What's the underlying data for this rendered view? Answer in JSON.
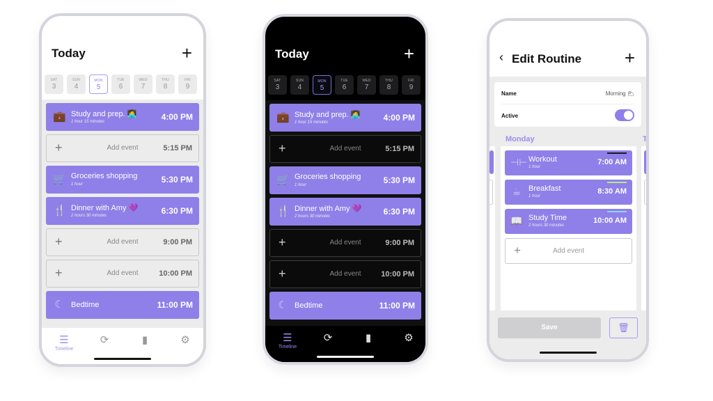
{
  "light": {
    "title": "Today",
    "days": [
      {
        "dow": "SAT",
        "num": "3"
      },
      {
        "dow": "SUN",
        "num": "4"
      },
      {
        "dow": "MON",
        "num": "5",
        "selected": true
      },
      {
        "dow": "TUE",
        "num": "6"
      },
      {
        "dow": "WED",
        "num": "7"
      },
      {
        "dow": "THU",
        "num": "8"
      },
      {
        "dow": "FRI",
        "num": "9"
      }
    ],
    "rows": [
      {
        "type": "event",
        "icon": "briefcase-icon",
        "name": "Study and prep. 🧑‍💻",
        "duration": "1 hour 15 minutes",
        "time": "4:00 PM"
      },
      {
        "type": "add",
        "label": "Add event",
        "time": "5:15 PM"
      },
      {
        "type": "event",
        "icon": "cart-icon",
        "name": "Groceries shopping",
        "duration": "1 hour",
        "time": "5:30 PM"
      },
      {
        "type": "event",
        "icon": "utensils-icon",
        "name": "Dinner with Amy 💜",
        "duration": "2 hours 30 minutes",
        "time": "6:30 PM"
      },
      {
        "type": "add",
        "label": "Add event",
        "time": "9:00 PM"
      },
      {
        "type": "add",
        "label": "Add event",
        "time": "10:00 PM"
      },
      {
        "type": "event",
        "icon": "moon-icon",
        "name": "Bedtime",
        "duration": "",
        "time": "11:00 PM"
      }
    ],
    "tabs": [
      {
        "label": "Timeline"
      }
    ]
  },
  "routine": {
    "title": "Edit Routine",
    "name_label": "Name",
    "name_value": "Morning 🌥",
    "active_label": "Active",
    "active": true,
    "column": "Monday",
    "next_column_initial": "T",
    "rows": [
      {
        "icon": "dumbbell-icon",
        "name": "Workout",
        "duration": "1 hour",
        "time": "7:00 AM",
        "tag": "#1a1a2e"
      },
      {
        "icon": "cup-icon",
        "name": "Breakfast",
        "duration": "1 hour",
        "time": "8:30 AM",
        "tag": "#b9e58a"
      },
      {
        "icon": "book-icon",
        "name": "Study Time",
        "duration": "2 hours 30 minutes",
        "time": "10:00 AM",
        "tag": "#8fd3f0"
      }
    ],
    "add_label": "Add event",
    "save_label": "Save"
  },
  "colors": {
    "accent": "#8f7fe8",
    "accent_light": "#9b8fef"
  }
}
